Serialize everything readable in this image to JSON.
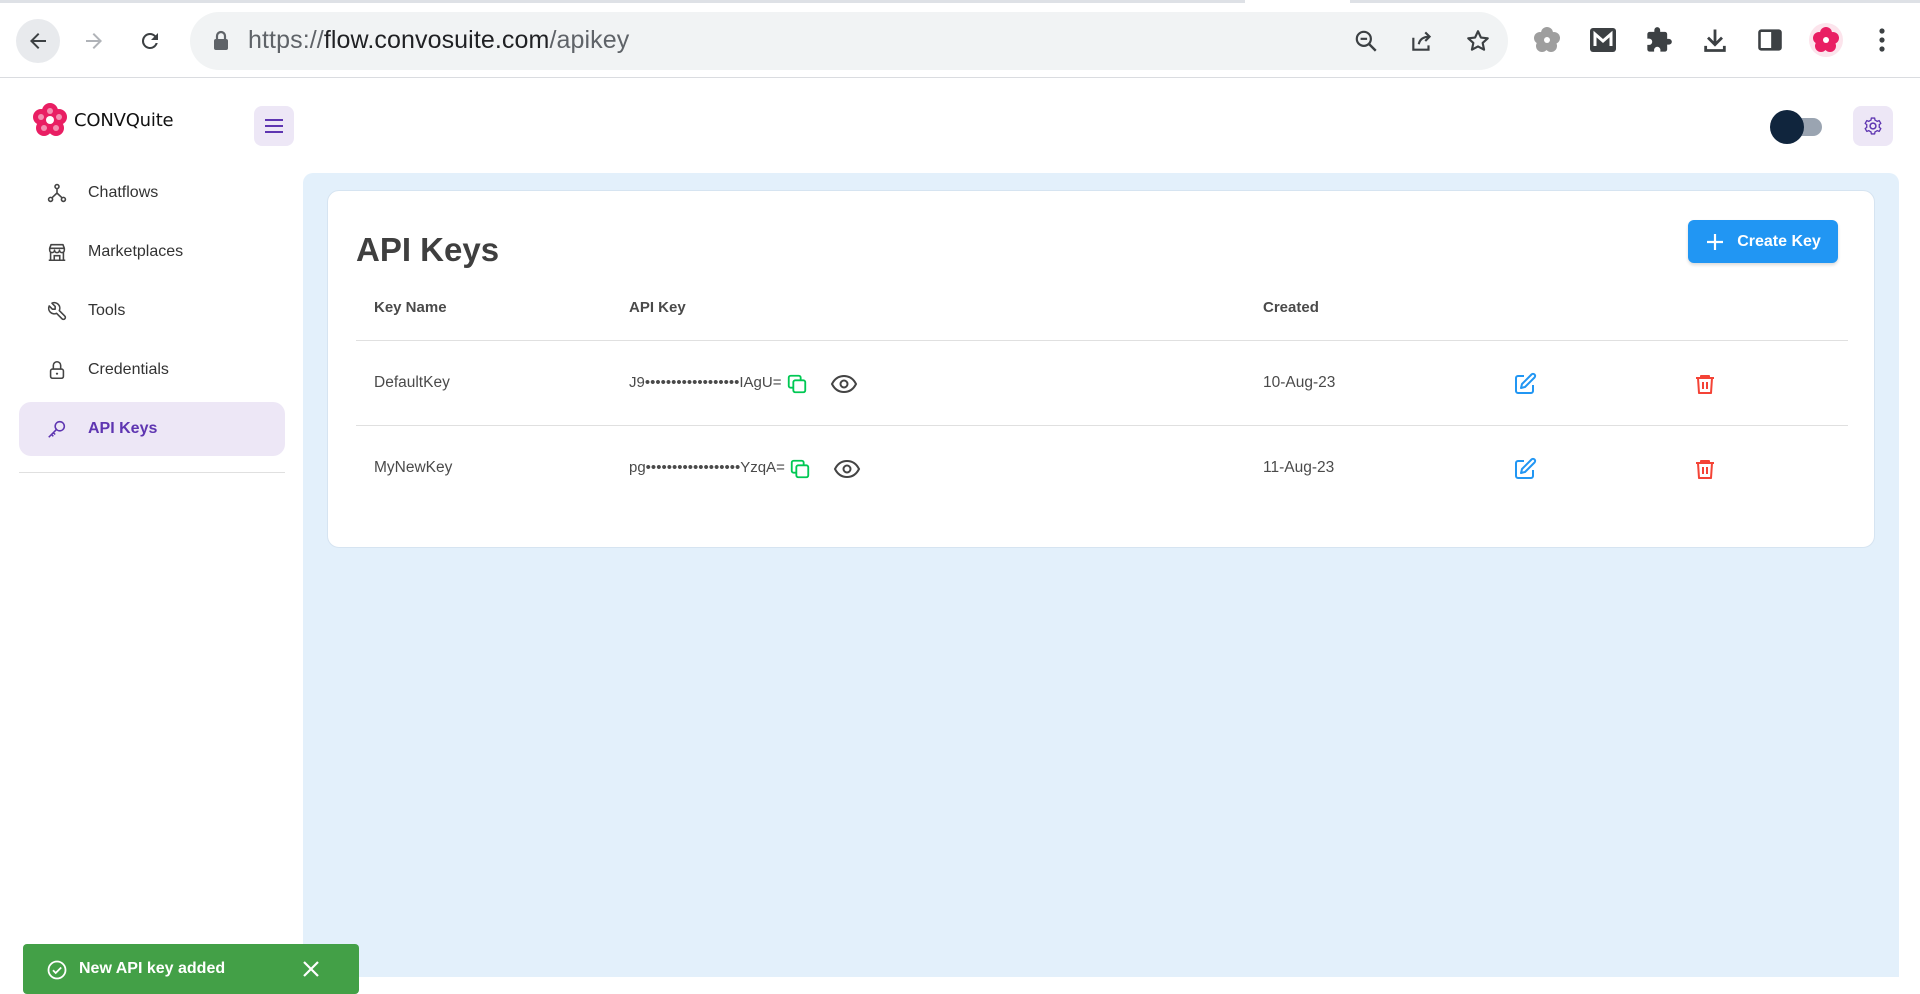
{
  "browser": {
    "url_scheme": "https://",
    "url_host": "flow.convosuite.com",
    "url_path": "/apikey"
  },
  "brand": {
    "logo_text": "CONVQuite",
    "logo_color": "#e91e63"
  },
  "sidebar": {
    "items": [
      {
        "label": "Chatflows",
        "icon": "chatflows-icon",
        "active": false
      },
      {
        "label": "Marketplaces",
        "icon": "store-icon",
        "active": false
      },
      {
        "label": "Tools",
        "icon": "wrench-icon",
        "active": false
      },
      {
        "label": "Credentials",
        "icon": "lock-icon",
        "active": false
      },
      {
        "label": "API Keys",
        "icon": "key-icon",
        "active": true
      }
    ]
  },
  "main": {
    "title": "API Keys",
    "create_button_label": "Create Key",
    "table": {
      "columns": [
        "Key Name",
        "API Key",
        "Created"
      ],
      "rows": [
        {
          "name": "DefaultKey",
          "key_masked": "J9••••••••••••••••••IAgU=",
          "created": "10-Aug-23"
        },
        {
          "name": "MyNewKey",
          "key_masked": "pg••••••••••••••••••YzqA=",
          "created": "11-Aug-23"
        }
      ]
    }
  },
  "toast": {
    "message": "New API key added"
  },
  "colors": {
    "accent_purple": "#5e35b1",
    "primary_blue": "#2196f3",
    "copy_green": "#00c853",
    "delete_red": "#f44336",
    "success_green": "#43a047"
  }
}
